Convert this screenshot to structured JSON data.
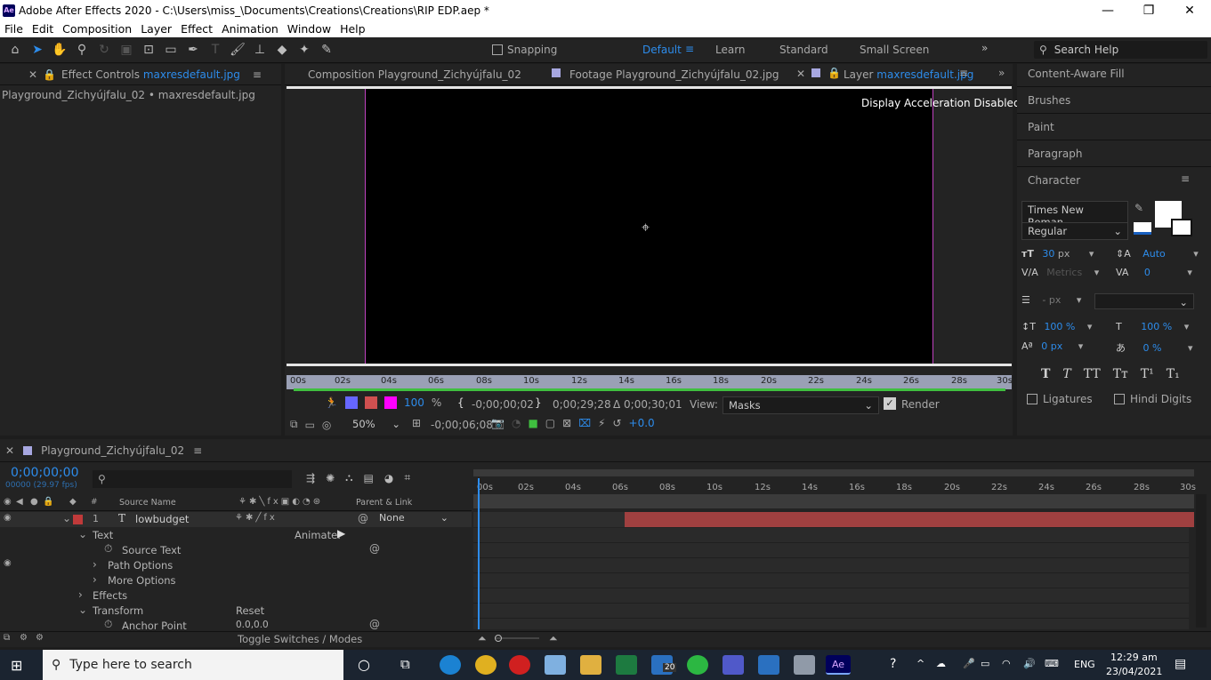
{
  "titlebar": {
    "logo": "Ae",
    "title": "Adobe After Effects 2020 - C:\\Users\\miss_\\Documents\\Creations\\Creations\\RIP EDP.aep *",
    "minimize": "—",
    "maximize": "❐",
    "close": "✕"
  },
  "menu": [
    "File",
    "Edit",
    "Composition",
    "Layer",
    "Effect",
    "Animation",
    "Window",
    "Help"
  ],
  "toolbar": {
    "snapping_label": "Snapping",
    "workspaces": [
      "Default",
      "Learn",
      "Standard",
      "Small Screen"
    ],
    "active_workspace": "Default",
    "search_placeholder": "Search Help"
  },
  "effect_controls": {
    "tab_prefix": "Effect Controls",
    "tab_file": "maxresdefault.jpg",
    "subtitle": "Playground_Zichyújfalu_02 • maxresdefault.jpg"
  },
  "comp_tabs": {
    "composition": "Composition Playground_Zichyújfalu_02",
    "footage": "Footage Playground_Zichyújfalu_02.jpg",
    "layer_prefix": "Layer",
    "layer_file": "maxresdefault.jpg"
  },
  "viewer": {
    "notice": "Display Acceleration Disabled",
    "ruler_ticks": [
      "00s",
      "02s",
      "04s",
      "06s",
      "08s",
      "10s",
      "12s",
      "14s",
      "16s",
      "18s",
      "20s",
      "22s",
      "24s",
      "26s",
      "28s",
      "30s"
    ],
    "zoom_percent": "100",
    "percent_sign": "%",
    "in_point": "-0;00;00;02",
    "out_point": "0;00;29;28",
    "duration": "Δ 0;00;30;01",
    "view_label": "View:",
    "view_value": "Masks",
    "render_label": "Render",
    "magnification": "50%",
    "current_time": "-0;00;06;08",
    "exposure": "+0.0"
  },
  "right_panel": {
    "items": [
      "Content-Aware Fill",
      "Brushes",
      "Paint",
      "Paragraph"
    ],
    "character_title": "Character",
    "font_family": "Times New Roman",
    "font_style": "Regular",
    "font_size": "30",
    "font_size_unit": "px",
    "leading": "Auto",
    "kerning": "Metrics",
    "tracking": "0",
    "stroke_width": "- px",
    "vert_scale": "100 %",
    "horiz_scale": "100 %",
    "baseline_shift": "0 px",
    "tsume": "0 %",
    "style_buttons": [
      "T",
      "T",
      "TT",
      "Tт",
      "T¹",
      "T₁"
    ],
    "ligatures": "Ligatures",
    "hindi_digits": "Hindi Digits"
  },
  "timeline": {
    "comp_name": "Playground_Zichyújfalu_02",
    "timecode": "0;00;00;00",
    "fps": "00000 (29.97 fps)",
    "search_placeholder": "",
    "col_number": "#",
    "col_source": "Source Name",
    "col_parent": "Parent & Link",
    "layer_number": "1",
    "layer_name": "lowbudget",
    "parent_value": "None",
    "props": {
      "text": "Text",
      "animate": "Animate:",
      "source_text": "Source Text",
      "path_options": "Path Options",
      "more_options": "More Options",
      "effects": "Effects",
      "transform": "Transform",
      "reset": "Reset",
      "anchor_point": "Anchor Point",
      "anchor_value": "0.0,0.0"
    },
    "footer": "Toggle Switches / Modes",
    "ticks": [
      "00s",
      "02s",
      "04s",
      "06s",
      "08s",
      "10s",
      "12s",
      "14s",
      "16s",
      "18s",
      "20s",
      "22s",
      "24s",
      "26s",
      "28s",
      "30s"
    ],
    "layer_bar_color": "#a04040"
  },
  "taskbar": {
    "search_placeholder": "Type here to search",
    "lang": "ENG",
    "time": "12:29 am",
    "date": "23/04/2021",
    "mail_badge": "20"
  }
}
